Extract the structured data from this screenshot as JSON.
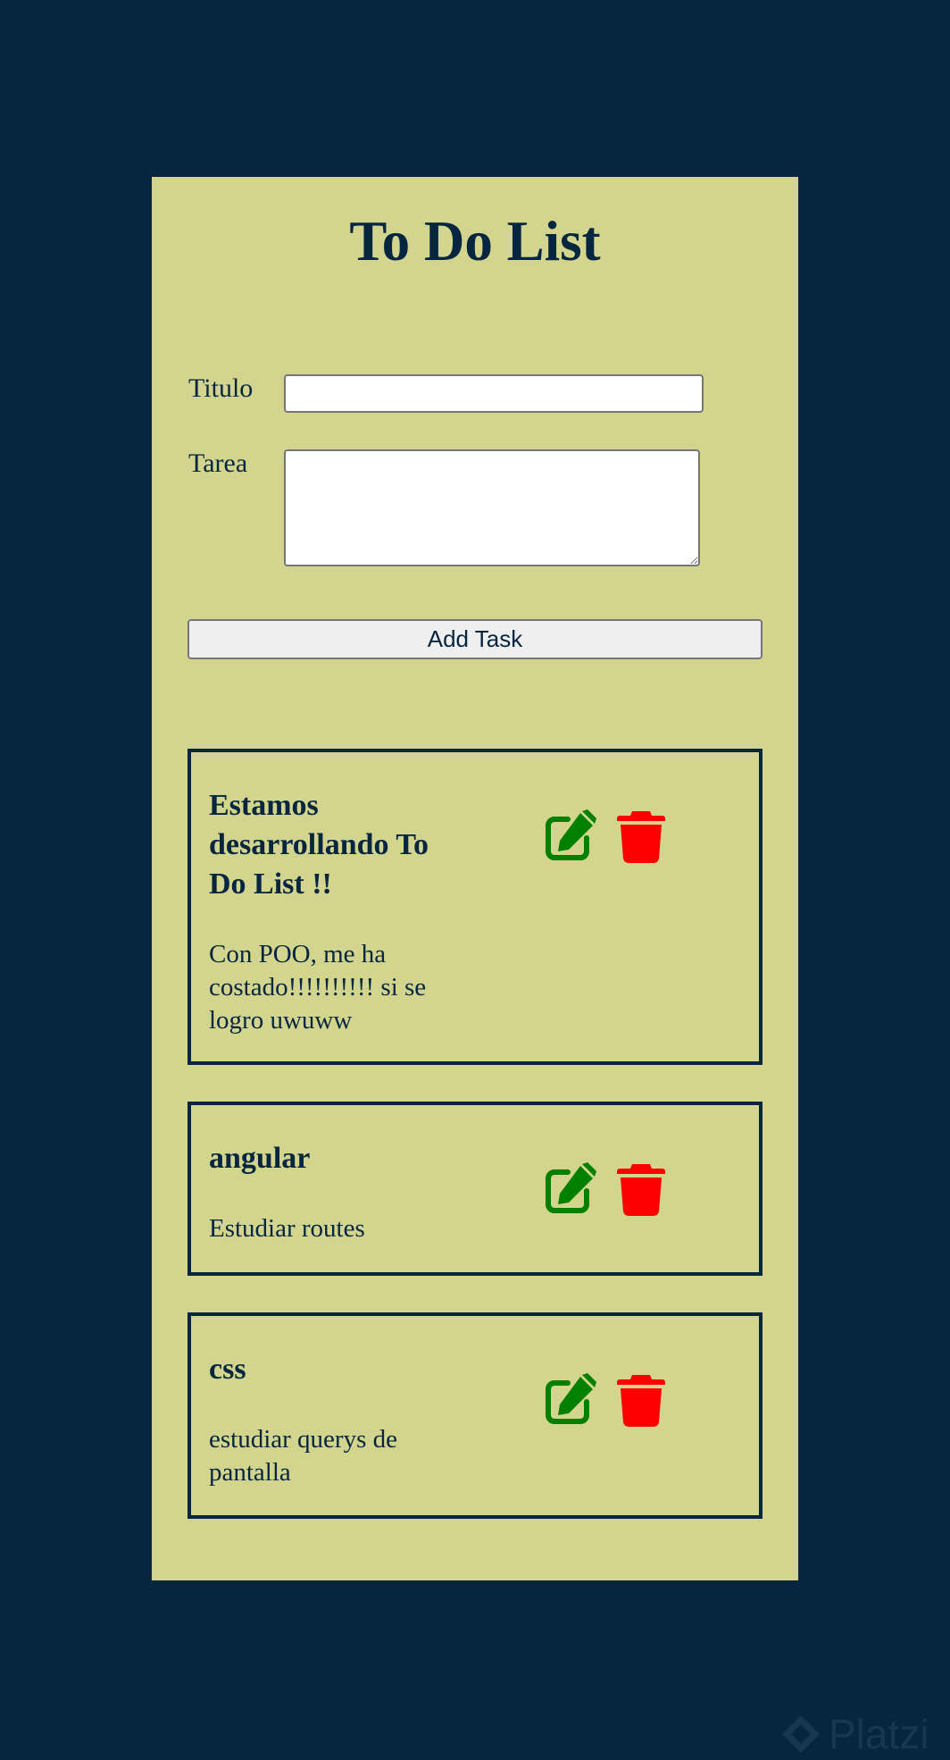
{
  "app": {
    "title": "To Do List",
    "bg_color": "#062640",
    "panel_color": "#d3d48d"
  },
  "form": {
    "titulo_label": "Titulo",
    "titulo_value": "",
    "tarea_label": "Tarea",
    "tarea_value": "",
    "add_button_label": "Add Task"
  },
  "tasks": [
    {
      "title": "Estamos desarrollando To Do List !!",
      "description": "Con POO, me ha costado!!!!!!!!!! si se logro uwuww"
    },
    {
      "title": "angular",
      "description": "Estudiar routes"
    },
    {
      "title": "css",
      "description": "estudiar querys de pantalla"
    }
  ],
  "icons": {
    "edit": "edit-icon",
    "delete": "trash-icon",
    "edit_color": "#008000",
    "delete_color": "#ff0000"
  },
  "watermark": {
    "text": "Platzi"
  }
}
